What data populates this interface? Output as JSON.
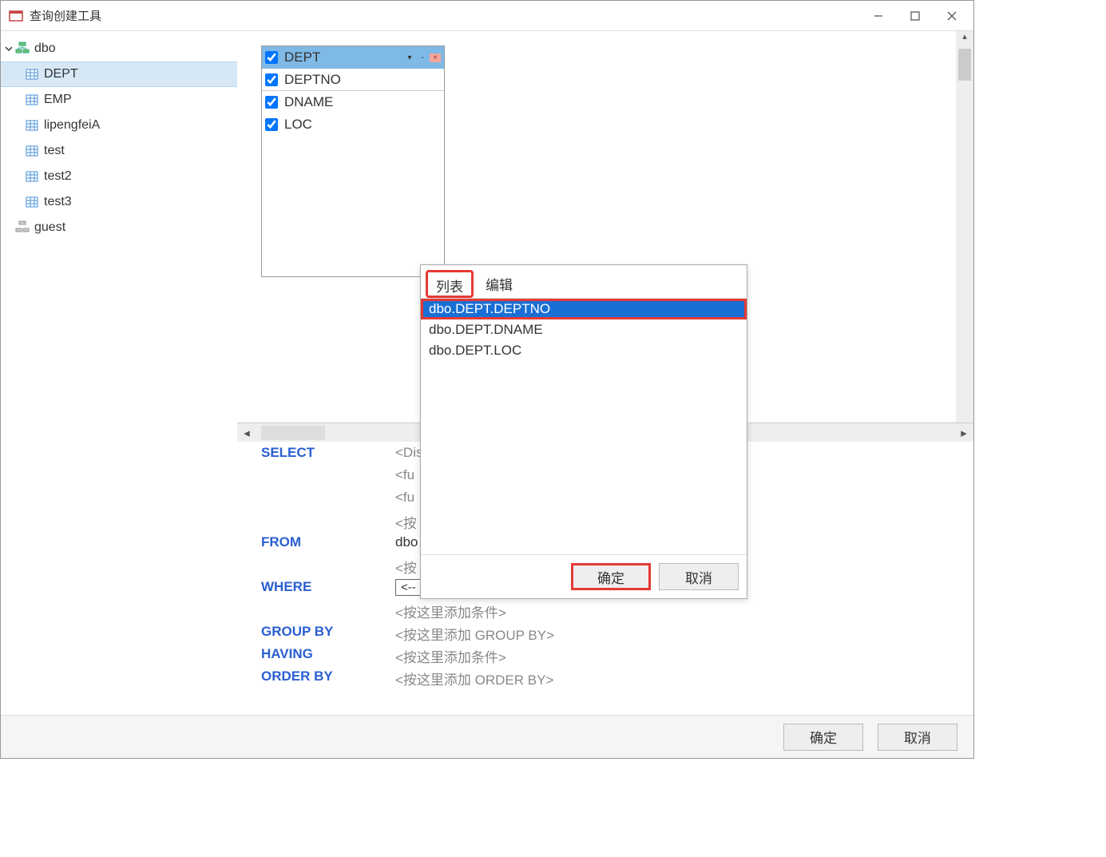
{
  "window": {
    "title": "查询创建工具"
  },
  "sidebar": {
    "schemas": [
      {
        "name": "dbo",
        "expanded": true,
        "tables": [
          "DEPT",
          "EMP",
          "lipengfeiA",
          "test",
          "test2",
          "test3"
        ],
        "selected": "DEPT"
      },
      {
        "name": "guest",
        "expanded": false,
        "tables": []
      }
    ]
  },
  "table_box": {
    "name": "DEPT",
    "columns": [
      "DEPTNO",
      "DNAME",
      "LOC"
    ]
  },
  "dialog": {
    "tabs": {
      "list": "列表",
      "edit": "编辑"
    },
    "items": [
      "dbo.DEPT.DEPTNO",
      "dbo.DEPT.DNAME",
      "dbo.DEPT.LOC"
    ],
    "selected": "dbo.DEPT.DEPTNO",
    "ok": "确定",
    "cancel": "取消"
  },
  "sql": {
    "select": "SELECT",
    "distinct_hint": "<Distinct>",
    "func_hint": "<fu",
    "add_hint": "<按",
    "from": "FROM",
    "from_val": "dbo",
    "where": "WHERE",
    "where_val": "<--",
    "where_add": "<按这里添加条件>",
    "group_by": "GROUP BY",
    "group_by_hint": "<按这里添加 GROUP BY>",
    "having": "HAVING",
    "having_hint": "<按这里添加条件>",
    "order_by": "ORDER BY",
    "order_by_hint": "<按这里添加 ORDER BY>"
  },
  "footer": {
    "ok": "确定",
    "cancel": "取消"
  }
}
